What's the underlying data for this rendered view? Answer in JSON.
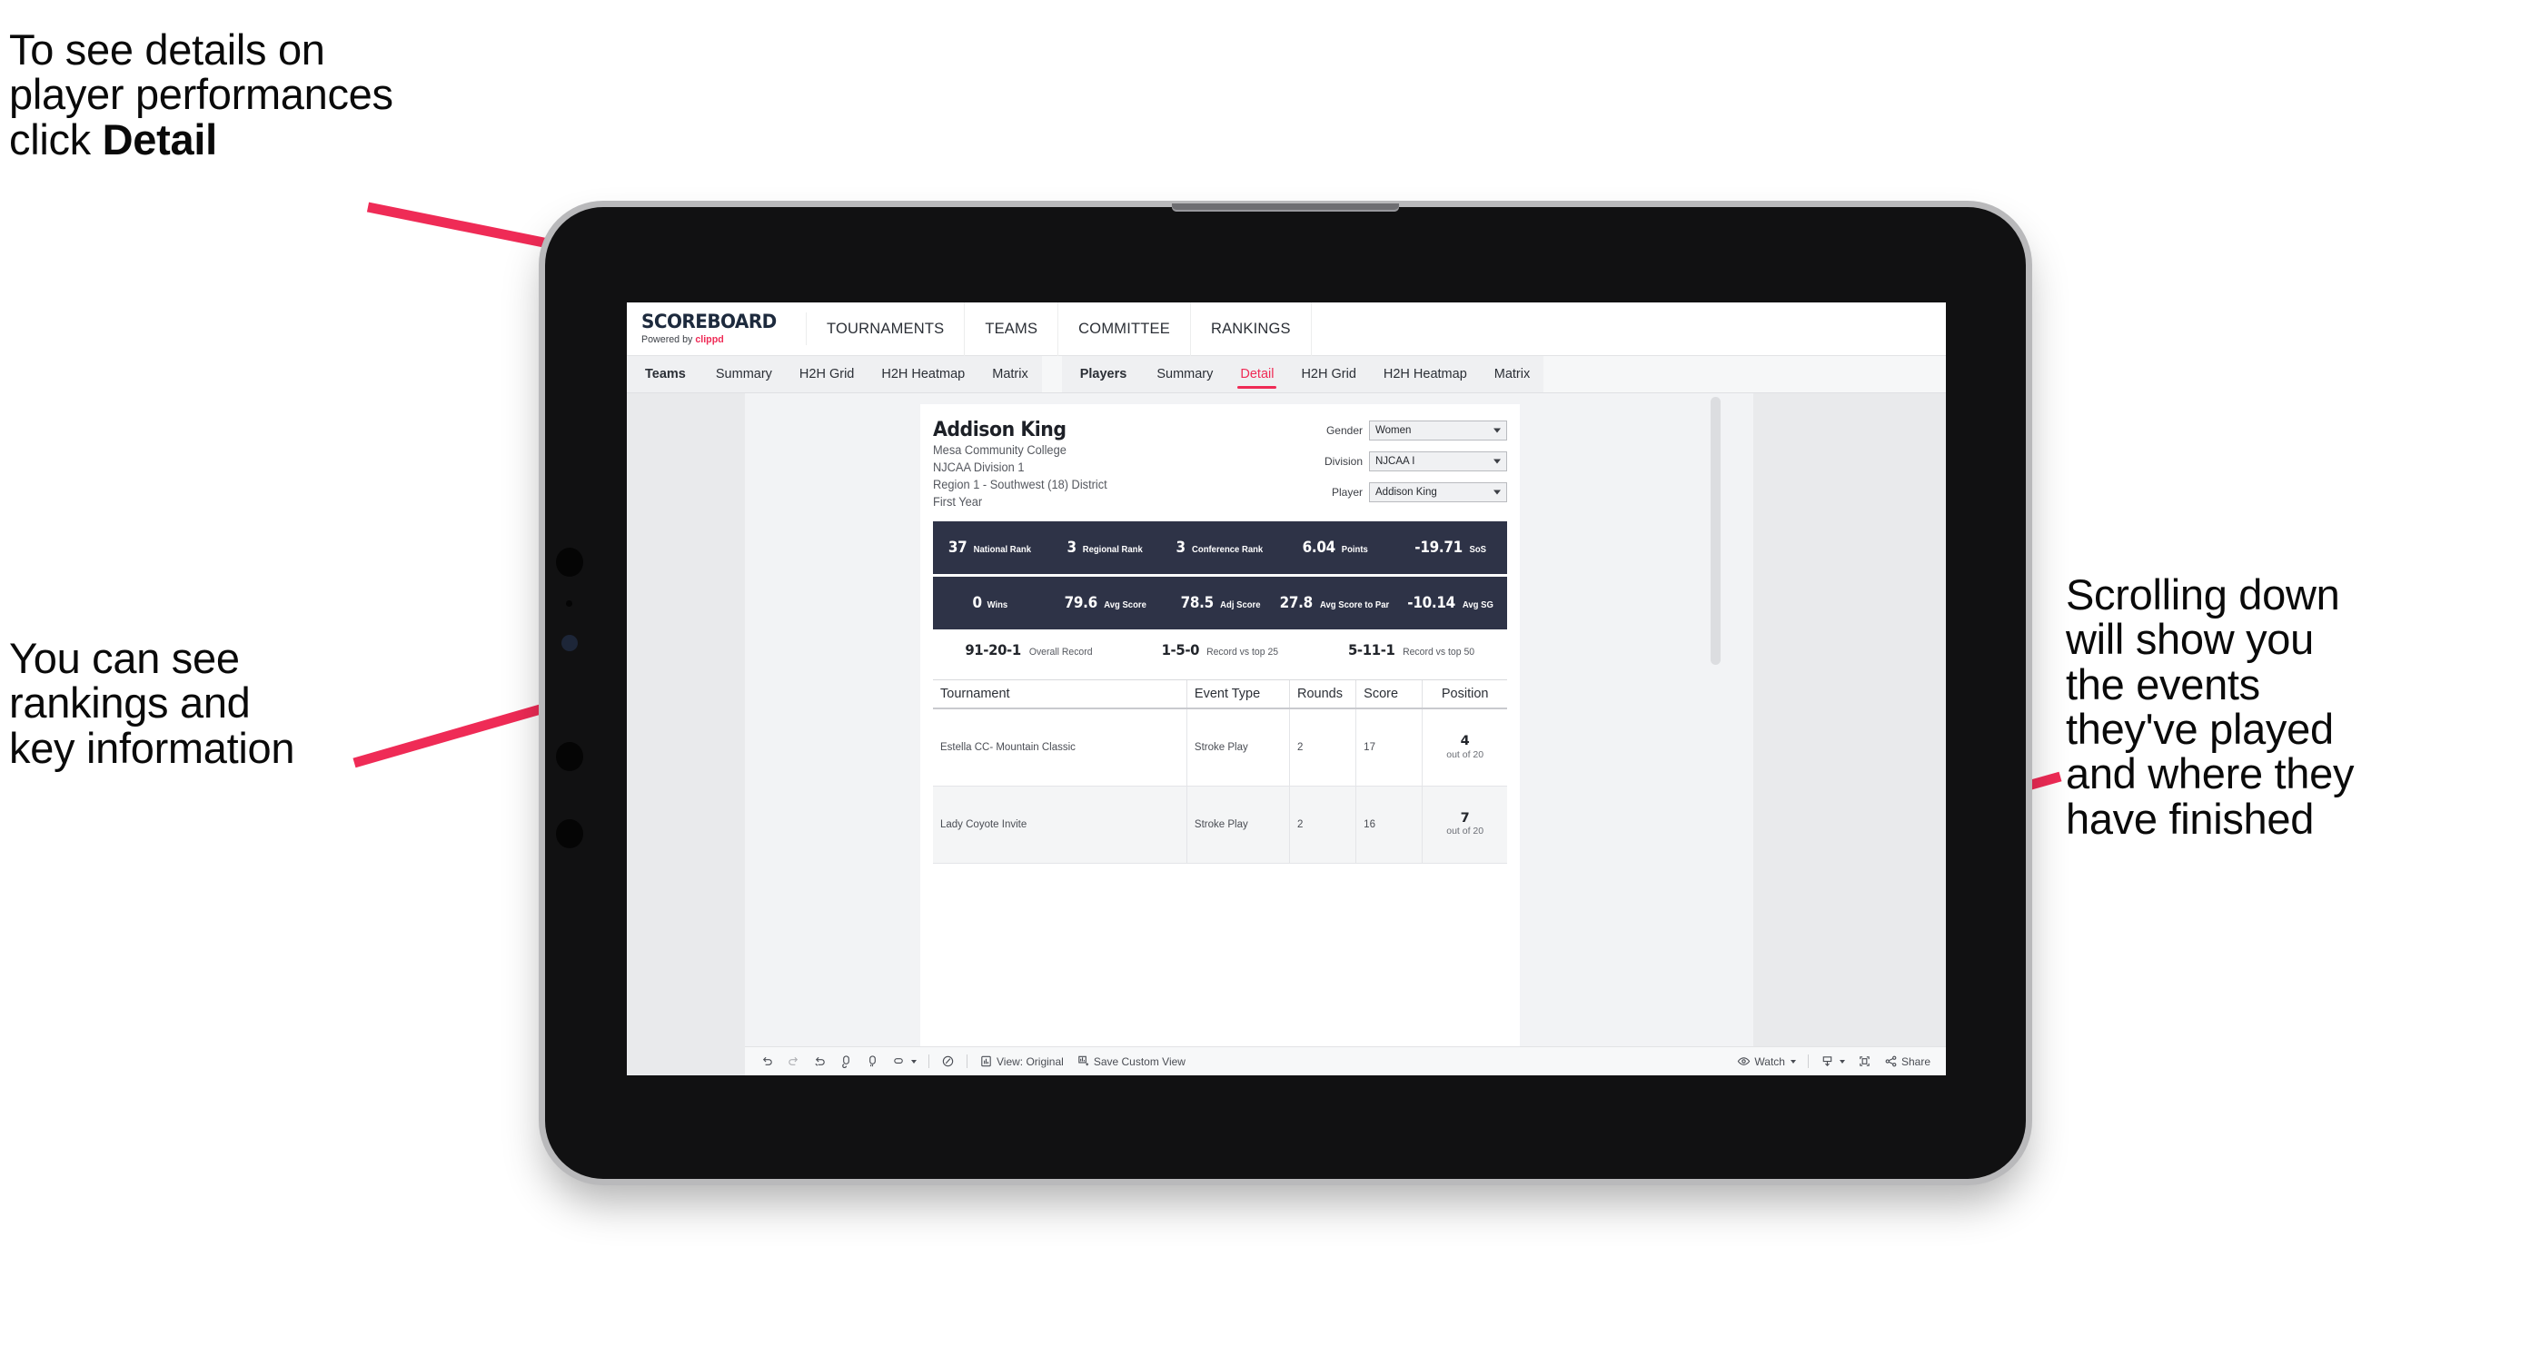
{
  "annotations": {
    "top_left": "To see details on\nplayer performances\nclick ",
    "top_left_bold": "Detail",
    "mid_left": "You can see\nrankings and\nkey information",
    "right": "Scrolling down\nwill show you\nthe events\nthey've played\nand where they\nhave finished",
    "arrow_color": "#ef2b56"
  },
  "app": {
    "logo_title": "SCOREBOARD",
    "logo_sub_prefix": "Powered by ",
    "logo_sub_brand": "clippd",
    "top_nav": [
      "TOURNAMENTS",
      "TEAMS",
      "COMMITTEE",
      "RANKINGS"
    ],
    "tabs_teams": [
      "Teams",
      "Summary",
      "H2H Grid",
      "H2H Heatmap",
      "Matrix"
    ],
    "tabs_players": [
      "Players",
      "Summary",
      "Detail",
      "H2H Grid",
      "H2H Heatmap",
      "Matrix"
    ],
    "active_tab": "Detail"
  },
  "player": {
    "name": "Addison King",
    "school": "Mesa Community College",
    "division": "NJCAA Division 1",
    "region": "Region 1 - Southwest (18) District",
    "year": "First Year"
  },
  "filters": [
    {
      "label": "Gender",
      "value": "Women"
    },
    {
      "label": "Division",
      "value": "NJCAA I"
    },
    {
      "label": "Player",
      "value": "Addison King"
    }
  ],
  "stats_row_1": [
    {
      "value": "37",
      "label": "National Rank"
    },
    {
      "value": "3",
      "label": "Regional Rank"
    },
    {
      "value": "3",
      "label": "Conference Rank"
    },
    {
      "value": "6.04",
      "label": "Points"
    },
    {
      "value": "-19.71",
      "label": "SoS"
    }
  ],
  "stats_row_2": [
    {
      "value": "0",
      "label": "Wins"
    },
    {
      "value": "79.6",
      "label": "Avg Score"
    },
    {
      "value": "78.5",
      "label": "Adj Score"
    },
    {
      "value": "27.8",
      "label": "Avg Score to Par"
    },
    {
      "value": "-10.14",
      "label": "Avg SG"
    }
  ],
  "records": [
    {
      "value": "91-20-1",
      "label": "Overall Record"
    },
    {
      "value": "1-5-0",
      "label": "Record vs top 25"
    },
    {
      "value": "5-11-1",
      "label": "Record vs top 50"
    }
  ],
  "events_table": {
    "columns": [
      "Tournament",
      "Event Type",
      "Rounds",
      "Score",
      "Position"
    ],
    "rows": [
      {
        "tournament": "Estella CC- Mountain Classic",
        "event_type": "Stroke Play",
        "rounds": "2",
        "score": "17",
        "position": "4",
        "position_of": "out of 20"
      },
      {
        "tournament": "Lady Coyote Invite",
        "event_type": "Stroke Play",
        "rounds": "2",
        "score": "16",
        "position": "7",
        "position_of": "out of 20"
      }
    ]
  },
  "toolbar": {
    "view_label": "View: Original",
    "save_label": "Save Custom View",
    "watch_label": "Watch",
    "share_label": "Share"
  },
  "colors": {
    "accent": "#ef2b56",
    "stat_bar": "#2e3347",
    "page_bg": "#e9eaec"
  }
}
